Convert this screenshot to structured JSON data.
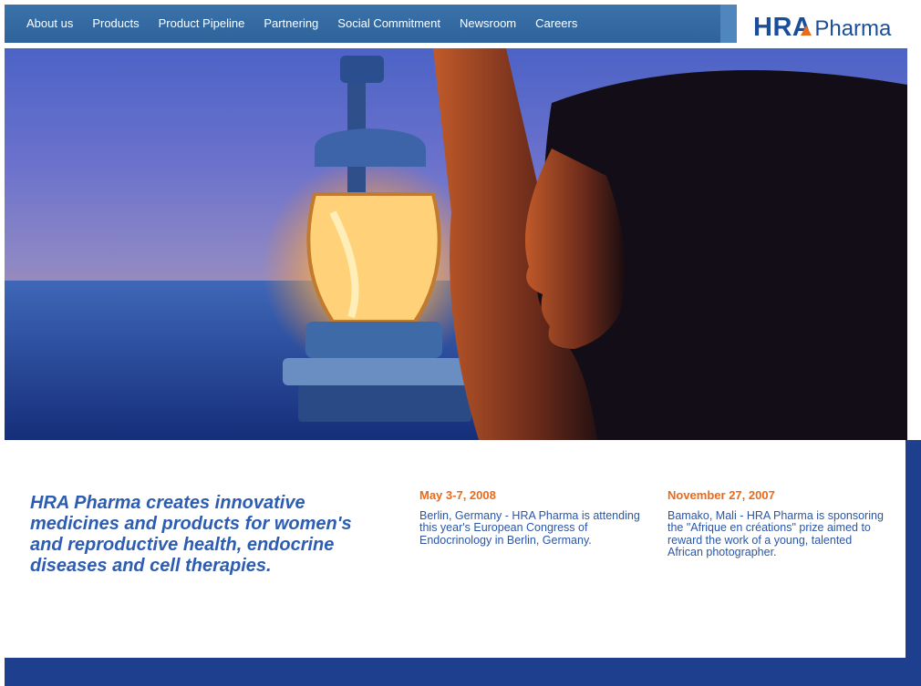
{
  "nav": {
    "items": [
      "About us",
      "Products",
      "Product Pipeline",
      "Partnering",
      "Social Commitment",
      "Newsroom",
      "Careers"
    ]
  },
  "logo": {
    "bold": "HRA",
    "light": "Pharma"
  },
  "hero": {
    "icon": "woman-with-lantern-photo"
  },
  "tagline": "HRA Pharma creates innovative medicines and products for women's and reproductive health, endocrine diseases and cell therapies.",
  "news": [
    {
      "date": "May 3-7, 2008",
      "text": "Berlin, Germany - HRA Pharma is attending this year's European Congress of Endocrinology in Berlin, Germany."
    },
    {
      "date": "November 27, 2007",
      "text": "Bamako, Mali - HRA Pharma is sponsoring the \"Afrique en créations\" prize aimed to reward the work of a young, talented African photographer."
    }
  ],
  "colors": {
    "nav": "#3a72aa",
    "accent": "#ec6a18",
    "brand": "#1a4e9b",
    "footer": "#1d3f8d"
  }
}
